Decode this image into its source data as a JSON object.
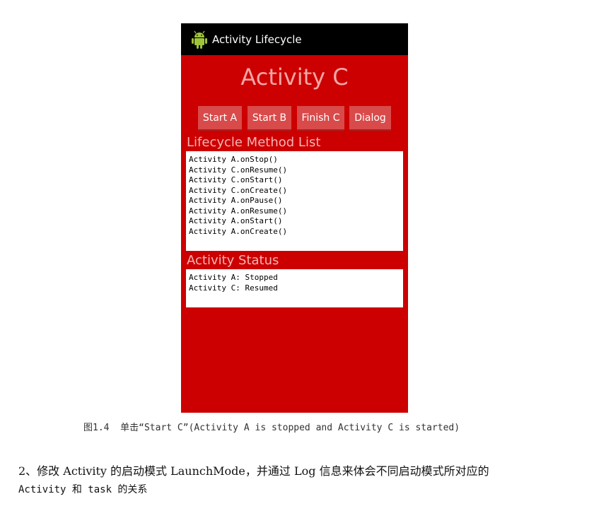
{
  "phone": {
    "title_bar": {
      "icon": "android-robot-icon",
      "title": "Activity Lifecycle"
    },
    "activity_title": "Activity C",
    "buttons": [
      {
        "label": "Start A"
      },
      {
        "label": "Start B"
      },
      {
        "label": "Finish C"
      },
      {
        "label": "Dialog"
      }
    ],
    "lifecycle_label": "Lifecycle Method List",
    "lifecycle_list": [
      "Activity A.onStop()",
      "Activity C.onResume()",
      "Activity C.onStart()",
      "Activity C.onCreate()",
      "Activity A.onPause()",
      "Activity A.onResume()",
      "Activity A.onStart()",
      "Activity A.onCreate()"
    ],
    "status_label": "Activity Status",
    "status_list": [
      "Activity A: Stopped",
      "Activity C: Resumed"
    ],
    "colors": {
      "background": "#cc0000",
      "title_bar": "#000000",
      "button": "#d94a4a",
      "title_text": "#f4a6a6"
    }
  },
  "caption": "图1.4  单击“Start C”(Activity A is stopped and Activity C is started)",
  "paragraph": {
    "line1": "2、修改 Activity 的启动模式 LaunchMode，并通过 Log 信息来体会不同启动模式所对应的",
    "line2": "Activity 和 task 的关系"
  }
}
